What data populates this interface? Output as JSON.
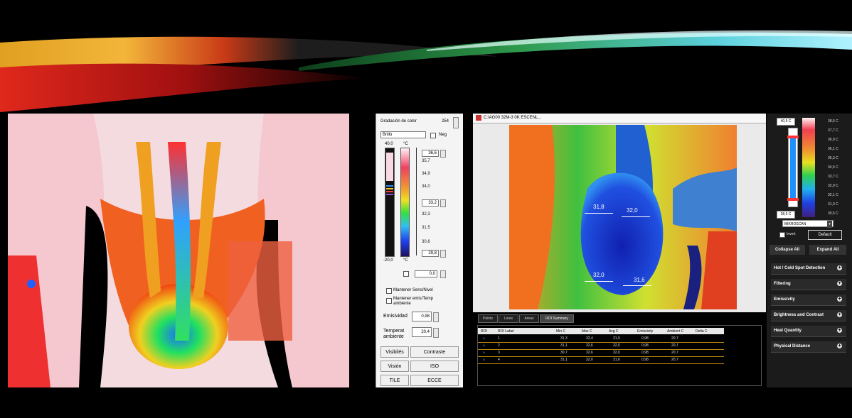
{
  "left_panel": {
    "gradient_label": "Gradación de color",
    "gradient_value": "254",
    "palette_select": "Brillo",
    "neg_label": "Neg",
    "scale_top": "40,0",
    "scale_unit": "°C",
    "scale_bottom": "-20,0",
    "scale_values": [
      "36,6",
      "35,7",
      "34,9",
      "34,0",
      "33,2",
      "32,3",
      "31,5",
      "30,6",
      "29,8"
    ],
    "extra_value": "0,0",
    "keep_sens_level": "Mantener Sens/Nivel",
    "keep_emis_temp": "Mantener emis/Temp ambiente",
    "emissivity_label": "Emisividad",
    "emissivity_value": "0,98",
    "ambient_label": "Temperat ambiente",
    "ambient_value": "20,4",
    "buttons": [
      "Visibilés",
      "Contraste",
      "Visión",
      "ISO",
      "TILE",
      "ECCE"
    ]
  },
  "right_window": {
    "title": "C:\\AG00 32M-3 0K ESCENL...",
    "temp_labels": [
      "31,8",
      "32,0",
      "32,0",
      "31,6"
    ],
    "tabs": [
      "Points",
      "Lines",
      "Areas",
      "ROI Summary"
    ],
    "table": {
      "headers": [
        "ROI",
        "ROI Label",
        "Min C",
        "Max C",
        "Avg C",
        "Emissivity",
        "Ambient C",
        "Delta C"
      ],
      "rows": [
        [
          "1",
          "31,3",
          "32,4",
          "31,9",
          "0,98",
          "20,7",
          ""
        ],
        [
          "2",
          "31,1",
          "32,6",
          "32,0",
          "0,98",
          "20,7",
          ""
        ],
        [
          "3",
          "30,7",
          "32,6",
          "32,0",
          "0,98",
          "20,7",
          ""
        ],
        [
          "4",
          "31,1",
          "32,0",
          "31,6",
          "0,98",
          "20,7",
          ""
        ]
      ]
    }
  },
  "right_panel": {
    "range_top": "40,5 C",
    "range_bottom": "28,5 C",
    "scale_values": [
      "38,5 C",
      "37,7 C",
      "36,9 C",
      "36,1 C",
      "35,3 C",
      "34,5 C",
      "33,7 C",
      "32,9 C",
      "32,1 C",
      "31,3 C",
      "30,5 C"
    ],
    "palette": "MIKROSCAN",
    "invert_label": "Invert",
    "default_label": "Default",
    "collapse_all": "Collapse All",
    "expand_all": "Expand All",
    "sections": [
      "Hot / Cold Spot Detection",
      "Filtering",
      "Emissivity",
      "Brightness and Contrast",
      "Heat Quantity",
      "Physical Distance"
    ]
  }
}
